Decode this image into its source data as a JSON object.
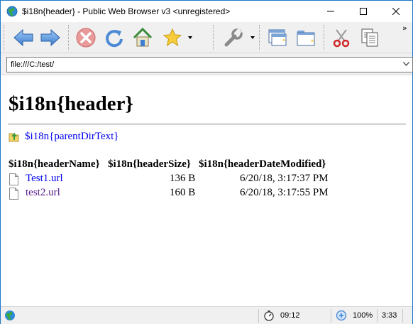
{
  "window": {
    "title": "$i18n{header} - Public Web Browser v3 <unregistered>"
  },
  "toolbar": {
    "back_icon": "back-arrow-icon",
    "forward_icon": "forward-arrow-icon",
    "stop_icon": "stop-icon",
    "refresh_icon": "refresh-icon",
    "home_icon": "home-icon",
    "favorites_icon": "star-icon",
    "tools_icon": "wrench-icon",
    "new_window_icon": "new-window-icon",
    "new_tab_icon": "new-tab-icon",
    "cut_icon": "scissors-icon",
    "copy_icon": "copy-icon",
    "overflow": "»"
  },
  "address": {
    "value": "file:///C:/test/"
  },
  "page": {
    "header": "$i18n{header}",
    "parent_dir": "$i18n{parentDirText}",
    "columns": {
      "name": "$i18n{headerName}",
      "size": "$i18n{headerSize}",
      "date": "$i18n{headerDateModified}"
    },
    "files": [
      {
        "name": "Test1.url",
        "size": "136 B",
        "date": "6/20/18, 3:17:37 PM"
      },
      {
        "name": "test2.url",
        "size": "160 B",
        "date": "6/20/18, 3:17:55 PM"
      }
    ]
  },
  "status": {
    "time_left": "09:12",
    "zoom": "100%",
    "clock": "3:33"
  },
  "colors": {
    "link": "#0000ee",
    "visited": "#551a8b",
    "accent": "#1979ca"
  }
}
